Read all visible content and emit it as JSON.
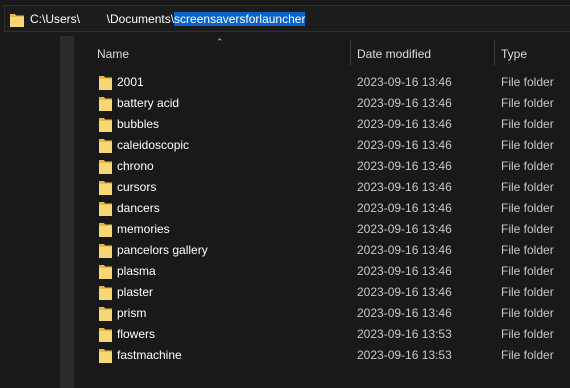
{
  "address": {
    "path_prefix": "C:\\Users\\        \\Documents\\",
    "path_selected": "screensaversforlauncher"
  },
  "columns": {
    "name": "Name",
    "date_modified": "Date modified",
    "type": "Type"
  },
  "colors": {
    "background": "#191919",
    "selection": "#0a64c8",
    "folder_yellow": "#f8d775"
  },
  "files": [
    {
      "name": "2001",
      "date": "2023-09-16 13:46",
      "type": "File folder"
    },
    {
      "name": "battery acid",
      "date": "2023-09-16 13:46",
      "type": "File folder"
    },
    {
      "name": "bubbles",
      "date": "2023-09-16 13:46",
      "type": "File folder"
    },
    {
      "name": "caleidoscopic",
      "date": "2023-09-16 13:46",
      "type": "File folder"
    },
    {
      "name": "chrono",
      "date": "2023-09-16 13:46",
      "type": "File folder"
    },
    {
      "name": "cursors",
      "date": "2023-09-16 13:46",
      "type": "File folder"
    },
    {
      "name": "dancers",
      "date": "2023-09-16 13:46",
      "type": "File folder"
    },
    {
      "name": "memories",
      "date": "2023-09-16 13:46",
      "type": "File folder"
    },
    {
      "name": "pancelors gallery",
      "date": "2023-09-16 13:46",
      "type": "File folder"
    },
    {
      "name": "plasma",
      "date": "2023-09-16 13:46",
      "type": "File folder"
    },
    {
      "name": "plaster",
      "date": "2023-09-16 13:46",
      "type": "File folder"
    },
    {
      "name": "prism",
      "date": "2023-09-16 13:46",
      "type": "File folder"
    },
    {
      "name": "flowers",
      "date": "2023-09-16 13:53",
      "type": "File folder"
    },
    {
      "name": "fastmachine",
      "date": "2023-09-16 13:53",
      "type": "File folder"
    }
  ]
}
